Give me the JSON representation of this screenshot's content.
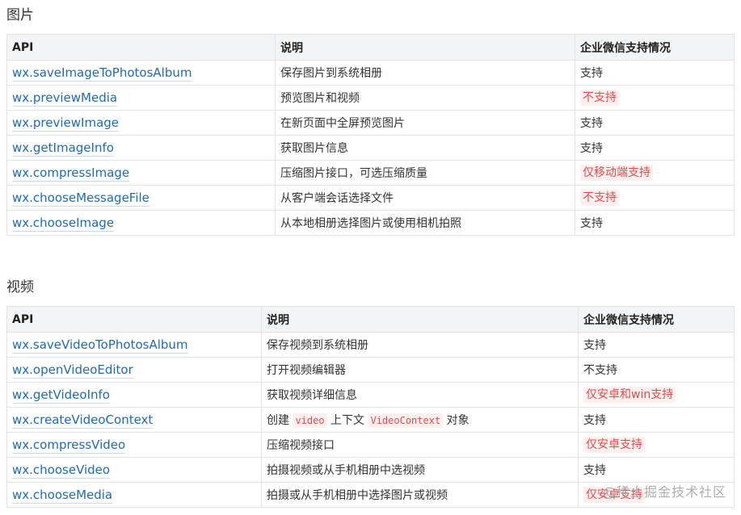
{
  "sections": [
    {
      "title": "图片",
      "headers": [
        "API",
        "说明",
        "企业微信支持情况"
      ],
      "rows": [
        {
          "api": "wx.saveImageToPhotosAlbum",
          "desc": "保存图片到系统相册",
          "support": "支持",
          "highlight": false
        },
        {
          "api": "wx.previewMedia",
          "desc": "预览图片和视频",
          "support": "不支持",
          "highlight": true
        },
        {
          "api": "wx.previewImage",
          "desc": "在新页面中全屏预览图片",
          "support": "支持",
          "highlight": false
        },
        {
          "api": "wx.getImageInfo",
          "desc": "获取图片信息",
          "support": "支持",
          "highlight": false
        },
        {
          "api": "wx.compressImage",
          "desc": "压缩图片接口，可选压缩质量",
          "support": "仅移动端支持",
          "highlight": true
        },
        {
          "api": "wx.chooseMessageFile",
          "desc": "从客户端会话选择文件",
          "support": "不支持",
          "highlight": true
        },
        {
          "api": "wx.chooseImage",
          "desc": "从本地相册选择图片或使用相机拍照",
          "support": "支持",
          "highlight": false
        }
      ]
    },
    {
      "title": "视频",
      "headers": [
        "API",
        "说明",
        "企业微信支持情况"
      ],
      "rows": [
        {
          "api": "wx.saveVideoToPhotosAlbum",
          "desc": "保存视频到系统相册",
          "support": "支持",
          "highlight": false
        },
        {
          "api": "wx.openVideoEditor",
          "desc": "打开视频编辑器",
          "support": "不支持",
          "highlight": false
        },
        {
          "api": "wx.getVideoInfo",
          "desc": "获取视频详细信息",
          "support": "仅安卓和win支持",
          "highlight": true
        },
        {
          "api": "wx.createVideoContext",
          "desc_parts": [
            "创建 ",
            "video",
            " 上下文 ",
            "VideoContext",
            " 对象"
          ],
          "support": "支持",
          "highlight": false
        },
        {
          "api": "wx.compressVideo",
          "desc": "压缩视频接口",
          "support": "仅安卓支持",
          "highlight": true
        },
        {
          "api": "wx.chooseVideo",
          "desc": "拍摄视频或从手机相册中选视频",
          "support": "支持",
          "highlight": false
        },
        {
          "api": "wx.chooseMedia",
          "desc": "拍摄或从手机相册中选择图片或视频",
          "support": "仅安卓支持",
          "highlight": true
        }
      ]
    }
  ],
  "watermark": "@稀土掘金技术社区"
}
